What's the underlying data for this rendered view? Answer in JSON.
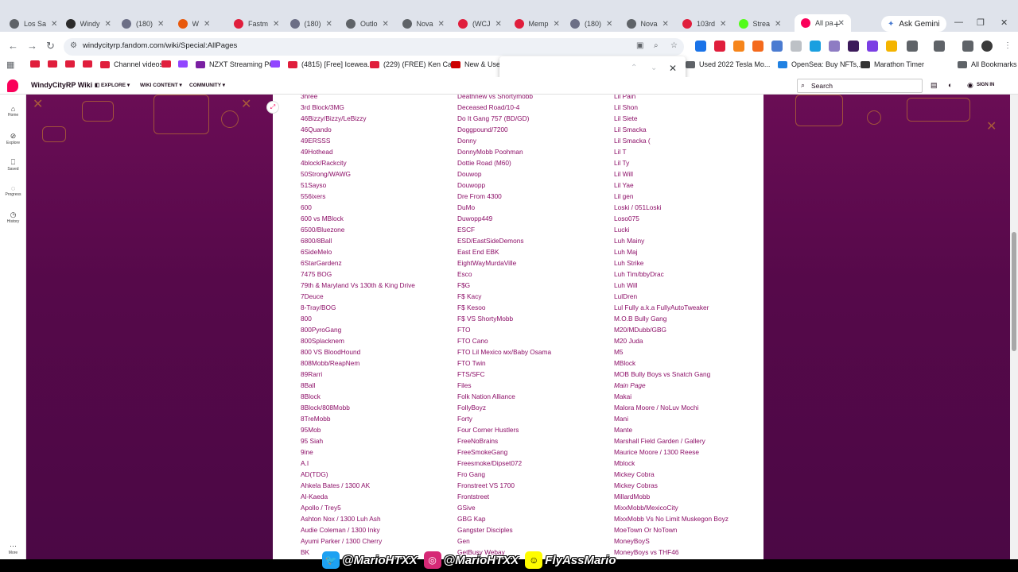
{
  "browser": {
    "tabs": [
      {
        "title": "Los Sa",
        "color": "#5f6368"
      },
      {
        "title": "Windy",
        "color": "#2b2b2b"
      },
      {
        "title": "(180)",
        "color": "#6c6f86"
      },
      {
        "title": "W",
        "color": "#e8590c"
      },
      {
        "title": "Fastm",
        "color": "#e01e3c"
      },
      {
        "title": "(180)",
        "color": "#6c6f86"
      },
      {
        "title": "Outlo",
        "color": "#5f6368"
      },
      {
        "title": "Nova",
        "color": "#5f6368"
      },
      {
        "title": "(WCJ",
        "color": "#e01e3c"
      },
      {
        "title": "Memp",
        "color": "#e01e3c"
      },
      {
        "title": "(180)",
        "color": "#6c6f86"
      },
      {
        "title": "Nova",
        "color": "#5f6368"
      },
      {
        "title": "103rd",
        "color": "#e01e3c"
      },
      {
        "title": "Strea",
        "color": "#53fc18"
      },
      {
        "title": "All pa",
        "color": "#fa005a",
        "active": true
      }
    ],
    "new_tab": "+",
    "ask_gemini": "Ask Gemini",
    "url": "windycityrp.fandom.com/wiki/Special:AllPages",
    "bookmarks": [
      {
        "label": "",
        "color": "#e01e3c"
      },
      {
        "label": "",
        "color": "#e01e3c"
      },
      {
        "label": "",
        "color": "#e01e3c"
      },
      {
        "label": "",
        "color": "#e01e3c"
      },
      {
        "label": "Channel videos",
        "color": "#e01e3c"
      },
      {
        "label": "",
        "color": "#e01e3c"
      },
      {
        "label": "",
        "color": "#9146ff"
      },
      {
        "label": "NZXT Streaming PC",
        "color": "#7a1fa2"
      },
      {
        "label": "",
        "color": "#9146ff"
      },
      {
        "label": "(4815) [Free] Icewea...",
        "color": "#e01e3c"
      },
      {
        "label": "(229) (FREE) Ken Car...",
        "color": "#e01e3c"
      },
      {
        "label": "New & Used",
        "color": "#cc0000"
      },
      {
        "label": "Used 2022 Tesla Mo...",
        "color": "#5f6368"
      },
      {
        "label": "OpenSea: Buy NFTs,...",
        "color": "#2081e2"
      },
      {
        "label": "Marathon Timer",
        "color": "#333333"
      },
      {
        "label": "All Bookmarks",
        "color": "#5f6368"
      }
    ]
  },
  "fandom": {
    "wiki_name": "WindyCityRP Wiki",
    "nav": [
      "EXPLORE",
      "WIKI CONTENT",
      "COMMUNITY"
    ],
    "search_placeholder": "Search",
    "sign_in": "SIGN IN",
    "rail": [
      "Home",
      "Explore",
      "Saved",
      "Progress",
      "History",
      "More"
    ]
  },
  "pages": {
    "col1": [
      "3hree",
      "3rd Block/3MG",
      "46Bizzy/Bizzy/LeBizzy",
      "46Quando",
      "49ERSSS",
      "49Hothead",
      "4block/Rackcity",
      "50Strong/WAWG",
      "51Sayso",
      "556ixers",
      "600",
      "600 vs MBlock",
      "6500/Bluezone",
      "6800/8Ball",
      "6SideMelo",
      "6StarGardenz",
      "7475 BOG",
      "79th & Maryland Vs 130th & King Drive",
      "7Deuce",
      "8-Tray/BOG",
      "800",
      "800PyroGang",
      "800Splacknem",
      "800 VS BloodHound",
      "808Mobb/ReapNem",
      "89Rarri",
      "8Ball",
      "8Block",
      "8Block/808Mobb",
      "8TreMobb",
      "95Mob",
      "95 Siah",
      "9ine",
      "A.I",
      "AD(TDG)",
      "Ahkela Bates / 1300 AK",
      "Al-Kaeda",
      "Apollo / Trey5",
      "Ashton Nox / 1300 Luh Ash",
      "Audie Coleman / 1300 Inky",
      "Ayumi Parker / 1300 Cherry",
      "BK"
    ],
    "col2": [
      "Deathnew vs Shortymobb",
      "Deceased Road/10-4",
      "Do It Gang 757 (BD/GD)",
      "Doggpound/7200",
      "Donny",
      "DonnyMobb Poohman",
      "Dottie Road (M60)",
      "Douwop",
      "Douwopp",
      "Dre From 4300",
      "DuMo",
      "Duwopp449",
      "ESCF",
      "ESD/EastSideDemons",
      "East End EBK",
      "EightWayMurdaVille",
      "Esco",
      "F$G",
      "F$ Kacy",
      "F$ Kesoo",
      "F$ VS ShortyMobb",
      "FTO",
      "FTO Cano",
      "FTO Lil Mexico мх/Baby Osama",
      "FTO Twin",
      "FTS/SFC",
      "Files",
      "Folk Nation Alliance",
      "FollyBoyz",
      "Forty",
      "Four Corner Hustlers",
      "FreeNoBrains",
      "FreeSmokeGang",
      "Freesmoke/Dipset072",
      "Fro Gang",
      "Fronstreet VS 1700",
      "Frontstreet",
      "GSive",
      "GBG Kap",
      "Gangster Disciples",
      "Gen",
      "GetBusy Webay"
    ],
    "col3": [
      "Lil Pain",
      "Lil Shon",
      "Lil Siete",
      "Lil Smacka",
      "Lil Smacka (",
      "Lil T",
      "Lil Ty",
      "Lil Will",
      "Lil Yae",
      "Lil gen",
      "Loski / 051Loski",
      "Loso075",
      "Lucki",
      "Luh Mainy",
      "Luh Maj",
      "Luh Strike",
      "Luh Tim/bbyDrac",
      "Luh Will",
      "LulDren",
      "Lul Fully a.k.a FullyAutoTweaker",
      "M.O.B Bully Gang",
      "M20/MDubb/GBG",
      "M20 Juda",
      "M5",
      "MBlock",
      "MOB Bully Boys vs Snatch Gang",
      "Main Page",
      "Makai",
      "Malora Moore / NoLuv Mochi",
      "Mani",
      "Mante",
      "Marshall Field Garden / Gallery",
      "Maurice Moore / 1300 Reese",
      "Mblock",
      "Mickey Cobra",
      "Mickey Cobras",
      "MillardMobb",
      "MixxMobb/MexicoCity",
      "MixxMobb Vs No Limit Muskegon Boyz",
      "MoeTown Or NoTown",
      "MoneyBoyS",
      "MoneyBoys vs THF46"
    ],
    "italic_items": [
      "Main Page"
    ]
  },
  "overlay": {
    "twitter": "@MarioHTXX",
    "instagram": "@MarioHTXX",
    "snapchat": "FlyAssMario",
    "colors": {
      "twitter": "#1da1f2",
      "instagram": "#d62976",
      "snapchat": "#fffc00"
    }
  }
}
